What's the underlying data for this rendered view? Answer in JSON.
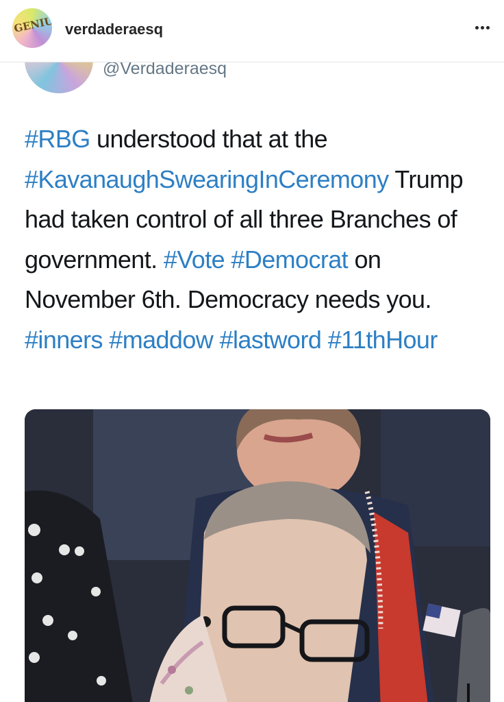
{
  "post_header": {
    "avatar_label": "GENIUS",
    "username": "verdaderaesq",
    "more_icon": "more-horizontal-icon"
  },
  "tweet": {
    "handle": "@Verdaderaesq",
    "segments": [
      {
        "text": "#RBG",
        "type": "hashtag"
      },
      {
        "text": " understood that at the ",
        "type": "plain"
      },
      {
        "text": "#KavanaughSwearingInCeremony",
        "type": "hashtag"
      },
      {
        "text": " Trump had taken control of all three Branches of government. ",
        "type": "plain"
      },
      {
        "text": "#Vote",
        "type": "hashtag"
      },
      {
        "text": " ",
        "type": "plain"
      },
      {
        "text": "#Democrat",
        "type": "hashtag"
      },
      {
        "text": " on November 6th. Democracy needs you. ",
        "type": "plain"
      },
      {
        "text": "#inners",
        "type": "hashtag"
      },
      {
        "text": " ",
        "type": "plain"
      },
      {
        "text": "#maddow",
        "type": "hashtag"
      },
      {
        "text": " ",
        "type": "plain"
      },
      {
        "text": "#lastword",
        "type": "hashtag"
      },
      {
        "text": " ",
        "type": "plain"
      },
      {
        "text": "#11thHour",
        "type": "hashtag"
      }
    ]
  },
  "colors": {
    "hashtag": "#2d7fc4",
    "text": "#14171a",
    "handle": "#657786"
  }
}
